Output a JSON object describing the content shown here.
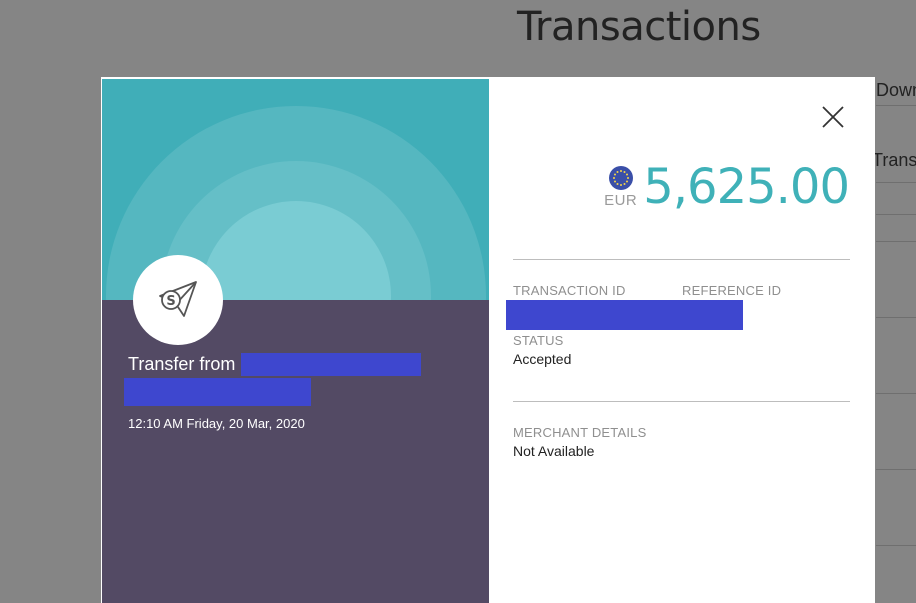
{
  "background": {
    "title": "Transactions",
    "link_partial": "Downloa",
    "col_partial": "Transactio"
  },
  "modal": {
    "transfer_prefix": "Transfer from",
    "datetime": "12:10 AM Friday, 20 Mar, 2020",
    "amount": "5,625.00",
    "currency": "EUR",
    "fields": {
      "transaction_id_label": "TRANSACTION ID",
      "reference_id_label": "REFERENCE ID",
      "status_label": "STATUS",
      "status_value": "Accepted",
      "merchant_label": "MERCHANT DETAILS",
      "merchant_value": "Not Available"
    },
    "icons": {
      "close": "close-icon",
      "logo": "paper-plane-s-icon",
      "flag": "eu-flag-icon"
    },
    "colors": {
      "accent": "#3fb1b8",
      "hero": "#40aeb8",
      "panel": "#534a64",
      "redaction": "#3e47cf"
    }
  }
}
